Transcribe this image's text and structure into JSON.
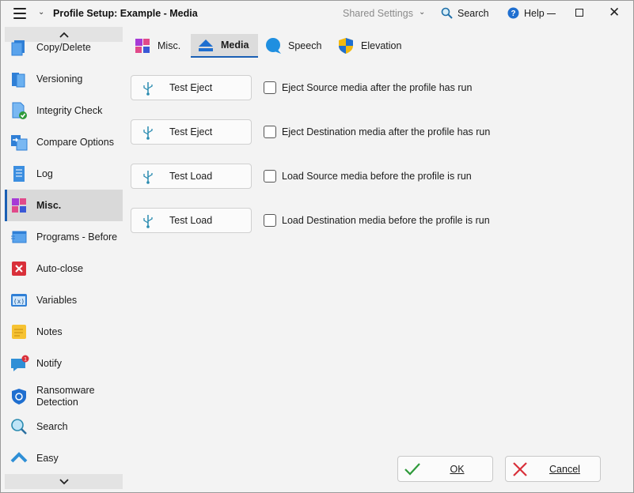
{
  "titlebar": {
    "title": "Profile Setup: Example - Media",
    "shared_settings": "Shared Settings",
    "search": "Search",
    "help": "Help"
  },
  "sidebar": {
    "items": [
      {
        "label": "Copy/Delete",
        "icon": "copy-delete-icon"
      },
      {
        "label": "Versioning",
        "icon": "versioning-icon"
      },
      {
        "label": "Integrity Check",
        "icon": "integrity-check-icon"
      },
      {
        "label": "Compare Options",
        "icon": "compare-options-icon"
      },
      {
        "label": "Log",
        "icon": "log-icon"
      },
      {
        "label": "Misc.",
        "icon": "misc-icon",
        "active": true
      },
      {
        "label": "Programs - Before",
        "icon": "programs-icon"
      },
      {
        "label": "Auto-close",
        "icon": "auto-close-icon"
      },
      {
        "label": "Variables",
        "icon": "variables-icon"
      },
      {
        "label": "Notes",
        "icon": "notes-icon"
      },
      {
        "label": "Notify",
        "icon": "notify-icon",
        "badge": "1"
      },
      {
        "label": "Ransomware Detection",
        "icon": "shield-icon"
      },
      {
        "label": "Search",
        "icon": "search-icon"
      },
      {
        "label": "Easy",
        "icon": "chevron-up-icon"
      }
    ]
  },
  "tabs": [
    {
      "label": "Misc.",
      "icon": "misc-icon"
    },
    {
      "label": "Media",
      "icon": "eject-icon",
      "active": true
    },
    {
      "label": "Speech",
      "icon": "speech-icon"
    },
    {
      "label": "Elevation",
      "icon": "uac-shield-icon"
    }
  ],
  "actions": [
    {
      "button": "Test Eject",
      "checkbox": "Eject Source media after the profile has run",
      "checked": false
    },
    {
      "button": "Test Eject",
      "checkbox": "Eject Destination media after the profile has run",
      "checked": false
    },
    {
      "button": "Test Load",
      "checkbox": "Load Source media before the profile is run",
      "checked": false
    },
    {
      "button": "Test Load",
      "checkbox": "Load Destination media before the profile is run",
      "checked": false
    }
  ],
  "footer": {
    "ok": "OK",
    "cancel": "Cancel"
  },
  "colors": {
    "accent": "#1a5fb4",
    "ok_check": "#2e9a3a",
    "cancel_x": "#d9303a",
    "usb": "#2a8bb0"
  }
}
